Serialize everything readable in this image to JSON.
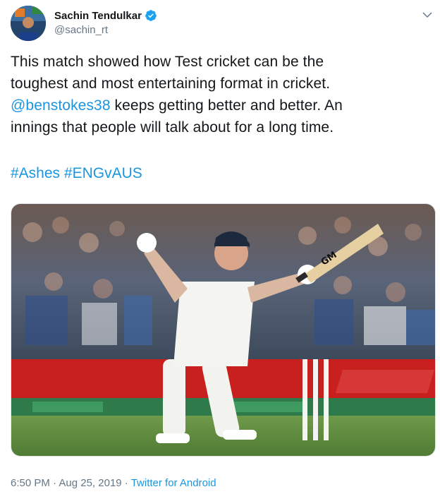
{
  "author": {
    "display_name": "Sachin Tendulkar",
    "handle": "@sachin_rt",
    "verified": true,
    "avatar_icon": "avatar-photo"
  },
  "tweet": {
    "line1": "This match showed how Test cricket can be the",
    "line2": "toughest and most entertaining format in cricket.",
    "mention": "@benstokes38",
    "line3_rest": " keeps getting better and better. An",
    "line4": "innings that people will talk about for a long time.",
    "hashtag1": "#Ashes",
    "hashtag2": "#ENGvAUS"
  },
  "media": {
    "bat_label": "GM"
  },
  "meta": {
    "time": "6:50 PM",
    "separator1": " · ",
    "date": "Aug 25, 2019",
    "separator2": " · ",
    "source": "Twitter for Android"
  },
  "colors": {
    "link": "#1b95e0",
    "text": "#14171a",
    "muted": "#657786"
  }
}
